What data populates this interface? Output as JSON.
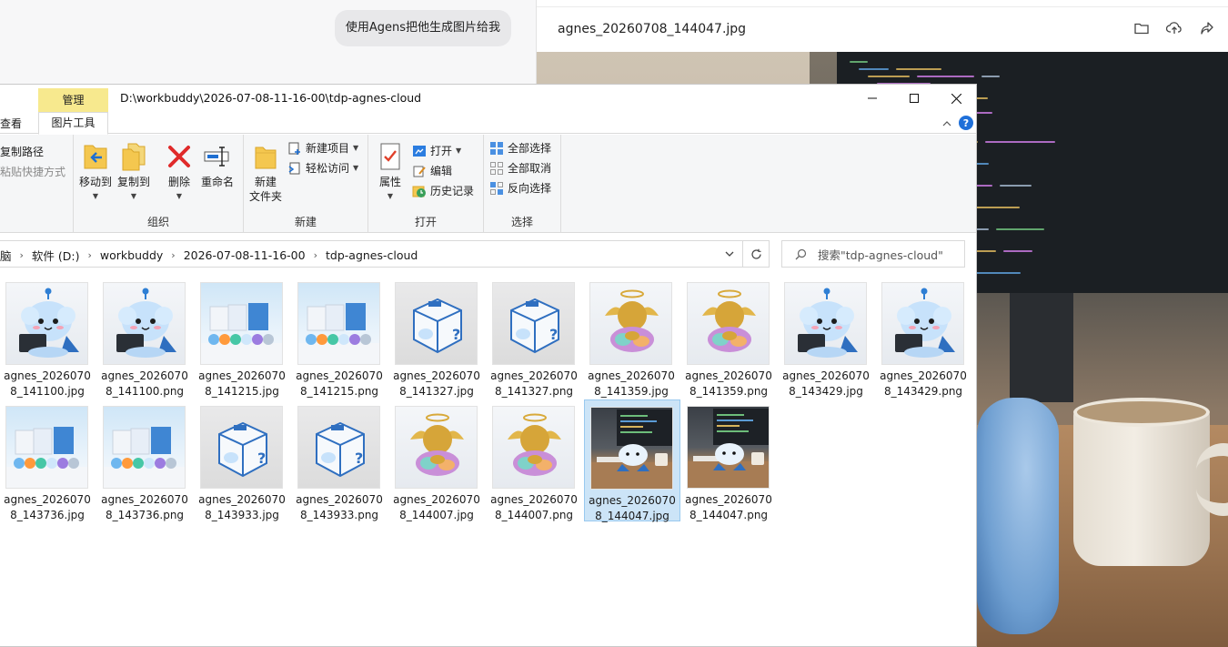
{
  "chat": {
    "message": "使用Agens把他生成图片给我"
  },
  "viewer": {
    "title": "agnes_20260708_144047.jpg",
    "actions": [
      "folder-icon",
      "upload-icon",
      "share-icon"
    ]
  },
  "explorer": {
    "manage_tab": "管理",
    "title_path": "D:\\workbuddy\\2026-07-08-11-16-00\\tdp-agnes-cloud",
    "tabs": {
      "view": "查看",
      "picture_tools": "图片工具"
    },
    "ribbon": {
      "copy_path": "复制路径",
      "paste_shortcut": "粘贴快捷方式",
      "move_to": "移动到",
      "copy_to": "复制到",
      "delete": "删除",
      "rename": "重命名",
      "group_organize": "组织",
      "new_folder_line1": "新建",
      "new_folder_line2": "文件夹",
      "new_item": "新建项目",
      "easy_access": "轻松访问",
      "group_new": "新建",
      "properties": "属性",
      "open": "打开",
      "edit": "编辑",
      "history": "历史记录",
      "group_open": "打开",
      "select_all": "全部选择",
      "select_none": "全部取消",
      "invert_selection": "反向选择",
      "group_select": "选择"
    },
    "breadcrumb": [
      "脑",
      "软件 (D:)",
      "workbuddy",
      "2026-07-08-11-16-00",
      "tdp-agnes-cloud"
    ],
    "search_placeholder": "搜索\"tdp-agnes-cloud\"",
    "files": [
      {
        "line1": "agnes_2026070",
        "line2": "8_141100.jpg",
        "art": "mascot-laptop"
      },
      {
        "line1": "agnes_2026070",
        "line2": "8_141100.png",
        "art": "mascot-laptop"
      },
      {
        "line1": "agnes_2026070",
        "line2": "8_141215.jpg",
        "art": "mascot-family"
      },
      {
        "line1": "agnes_2026070",
        "line2": "8_141215.png",
        "art": "mascot-family"
      },
      {
        "line1": "agnes_2026070",
        "line2": "8_141327.jpg",
        "art": "mystery-box"
      },
      {
        "line1": "agnes_2026070",
        "line2": "8_141327.png",
        "art": "mystery-box"
      },
      {
        "line1": "agnes_2026070",
        "line2": "8_141359.jpg",
        "art": "golden-angel"
      },
      {
        "line1": "agnes_2026070",
        "line2": "8_141359.png",
        "art": "golden-angel"
      },
      {
        "line1": "agnes_2026070",
        "line2": "8_143429.jpg",
        "art": "mascot-laptop"
      },
      {
        "line1": "agnes_2026070",
        "line2": "8_143429.png",
        "art": "mascot-laptop"
      },
      {
        "line1": "agnes_2026070",
        "line2": "8_143736.jpg",
        "art": "mascot-family"
      },
      {
        "line1": "agnes_2026070",
        "line2": "8_143736.png",
        "art": "mascot-family"
      },
      {
        "line1": "agnes_2026070",
        "line2": "8_143933.jpg",
        "art": "mystery-box"
      },
      {
        "line1": "agnes_2026070",
        "line2": "8_143933.png",
        "art": "mystery-box"
      },
      {
        "line1": "agnes_2026070",
        "line2": "8_144007.jpg",
        "art": "golden-angel"
      },
      {
        "line1": "agnes_2026070",
        "line2": "8_144007.png",
        "art": "golden-angel"
      },
      {
        "line1": "agnes_2026070",
        "line2": "8_144047.jpg",
        "art": "desk-scene",
        "selected": true
      },
      {
        "line1": "agnes_2026070",
        "line2": "8_144047.png",
        "art": "desk-scene"
      }
    ]
  }
}
